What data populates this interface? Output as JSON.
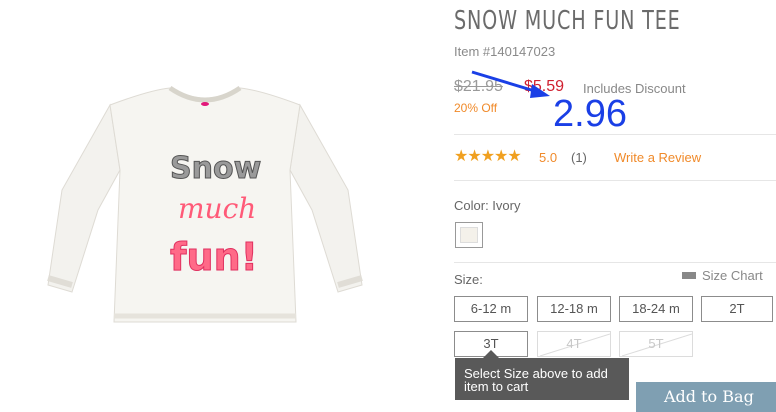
{
  "product": {
    "title": "SNOW MUCH FUN TEE",
    "item_number": "Item #140147023",
    "image_text": [
      "Snow",
      "much",
      "fun!"
    ]
  },
  "price": {
    "original": "$21.95",
    "sale": "$5.59",
    "includes": "Includes Discount",
    "percent_off": "20% Off"
  },
  "annotation": {
    "text": "2.96",
    "color": "#1a3fe6"
  },
  "rating": {
    "stars": "★★★★★",
    "value": "5.0",
    "count": "(1)",
    "write_review": "Write a Review"
  },
  "color": {
    "label": "Color: Ivory",
    "swatch_color": "#f4f1ea"
  },
  "size": {
    "label": "Size:",
    "chart_label": "Size Chart",
    "options": [
      {
        "label": "6-12 m",
        "available": true
      },
      {
        "label": "12-18 m",
        "available": true
      },
      {
        "label": "18-24 m",
        "available": true
      },
      {
        "label": "2T",
        "available": true
      },
      {
        "label": "3T",
        "available": true
      },
      {
        "label": "4T",
        "available": false
      },
      {
        "label": "5T",
        "available": false
      }
    ]
  },
  "tooltip": {
    "text": "Select Size above to add item to cart"
  },
  "cart": {
    "add_label": "Add to Bag"
  },
  "colors": {
    "sale_red": "#d02030",
    "accent_orange": "#f08a2a",
    "star_gold": "#f0a020",
    "add_button": "#7f9fb2"
  }
}
